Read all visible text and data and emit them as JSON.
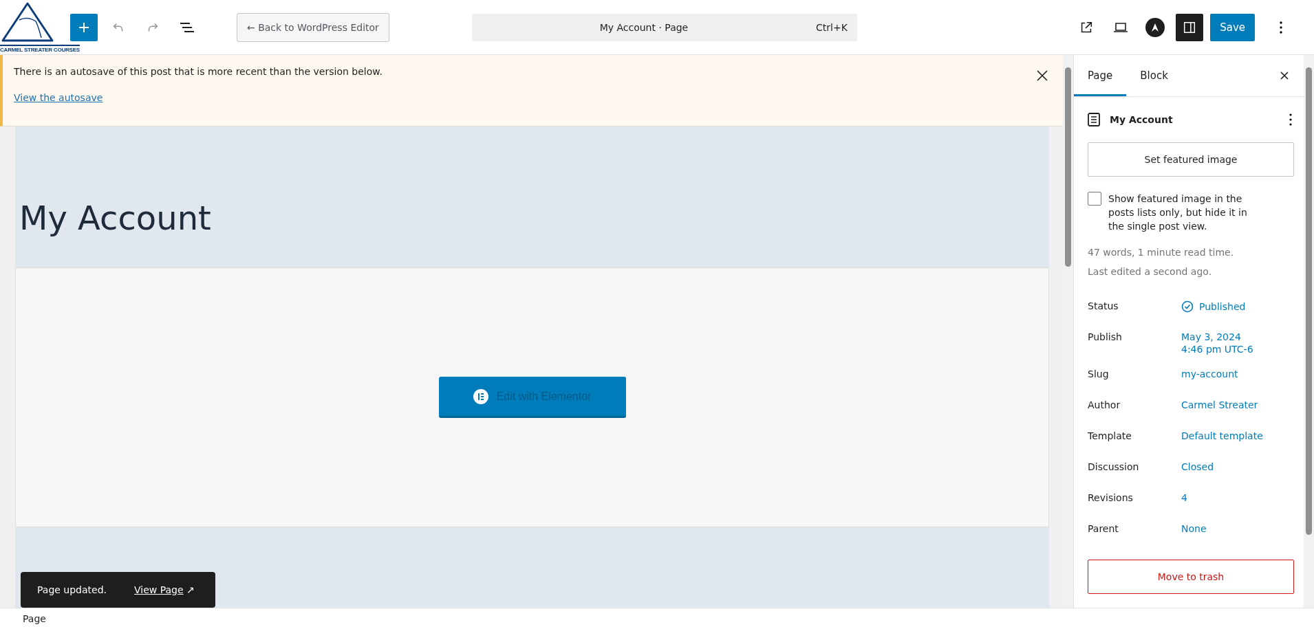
{
  "logo": {
    "text": "CARMEL STREATER COURSES"
  },
  "toolbar": {
    "back_button": "← Back to WordPress Editor",
    "command": {
      "title": "My Account · Page",
      "shortcut": "Ctrl+K"
    },
    "save_button": "Save",
    "settings_toggle": {
      "selected": true
    }
  },
  "notice": {
    "message": "There is an autosave of this post that is more recent than the version below.",
    "link": "View the autosave"
  },
  "canvas": {
    "title": "My Account",
    "elementor_button": "Edit with Elementor"
  },
  "snackbar": {
    "message": "Page updated.",
    "link": "View Page",
    "link_icon": "↗"
  },
  "sidebar": {
    "tabs": [
      {
        "label": "Page",
        "selected": true
      },
      {
        "label": "Block",
        "selected": false
      }
    ],
    "title": "My Account",
    "featured_button": "Set featured image",
    "checkbox": {
      "label": "Show featured image in the posts lists only, but hide it in the single post view.",
      "checked": false
    },
    "stats": [
      "47 words, 1 minute read time.",
      "Last edited a second ago."
    ],
    "fields": [
      {
        "label": "Status",
        "value": "Published",
        "kind": "status"
      },
      {
        "label": "Publish",
        "value": "May 3, 2024",
        "value_2": "4:46 pm UTC-6",
        "kind": "link"
      },
      {
        "label": "Slug",
        "value": "my-account",
        "kind": "link"
      },
      {
        "label": "Author",
        "value": "Carmel Streater",
        "kind": "link"
      },
      {
        "label": "Template",
        "value": "Default template",
        "kind": "link"
      },
      {
        "label": "Discussion",
        "value": "Closed",
        "kind": "link"
      },
      {
        "label": "Revisions",
        "value": "4",
        "kind": "link"
      },
      {
        "label": "Parent",
        "value": "None",
        "kind": "link"
      }
    ],
    "trash_button": "Move to trash"
  },
  "status_bar": {
    "breadcrumb": "Page"
  }
}
